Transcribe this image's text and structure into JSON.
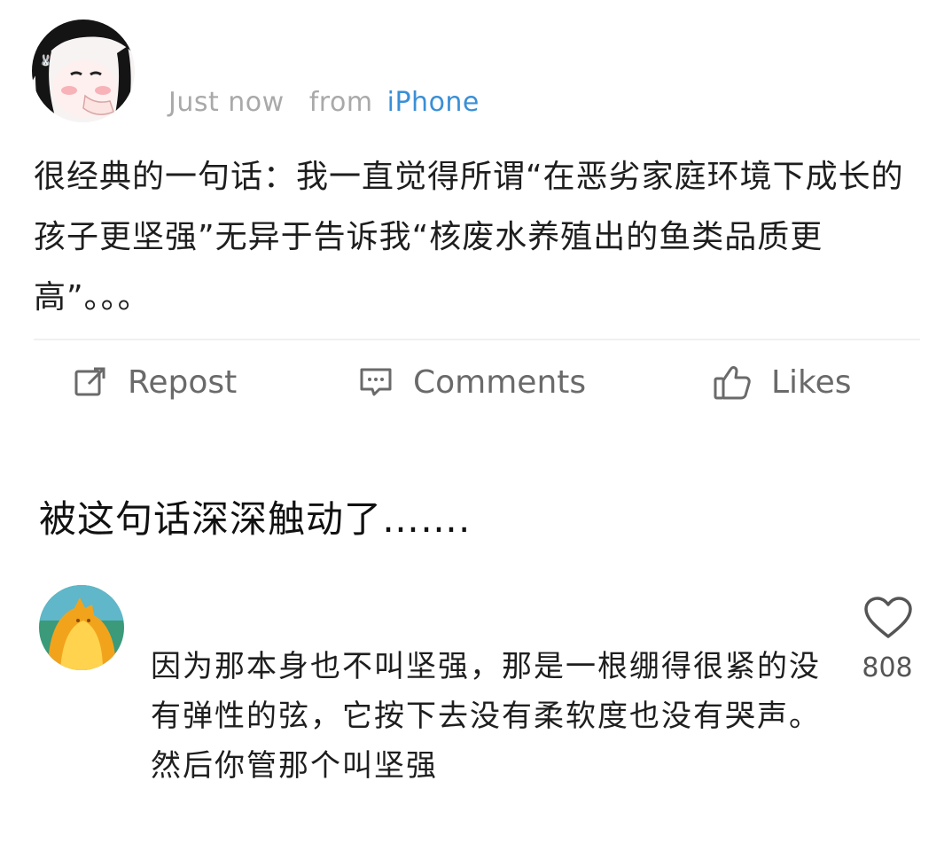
{
  "post": {
    "timestamp": "Just now",
    "from_label": "from",
    "device": "iPhone",
    "text": "很经典的一句话：我一直觉得所谓“在恶劣家庭环境下成长的孩子更坚强”无异于告诉我“核废水养殖出的鱼类品质更高”。。。"
  },
  "actions": {
    "repost": "Repost",
    "comments": "Comments",
    "likes": "Likes"
  },
  "caption": "被这句话深深触动了…….",
  "comment": {
    "text": "因为那本身也不叫坚强，那是一根绷得很紧的没有弹性的弦，它按下去没有柔软度也没有哭声。然后你管那个叫坚强",
    "like_count": "808"
  },
  "icons": {
    "repost": "repost-icon",
    "comments": "comment-icon",
    "likes": "thumbs-up-icon",
    "heart": "heart-icon"
  },
  "colors": {
    "device_link": "#3a8fd6",
    "meta_gray": "#a9a9a9",
    "action_gray": "#6a6a6a"
  }
}
